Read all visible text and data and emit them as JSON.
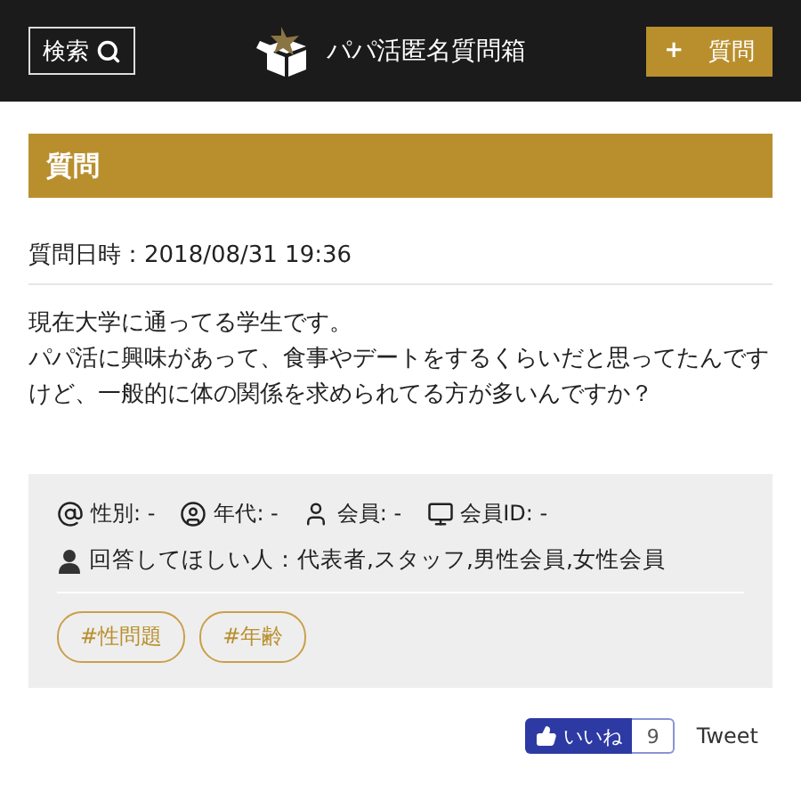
{
  "header": {
    "search_button": "検索",
    "site_title": "パパ活匿名質問箱",
    "ask_button": "+",
    "ask_label": "質問"
  },
  "section_title": "質問",
  "question": {
    "date": "質問日時：2018/08/31 19:36",
    "body": [
      "現在大学に通ってる学生です。",
      "パパ活に興味があって、食事やデートをするくらいだと思ってたんですけど、一般的に体の関係を求められてる方が多いんですか？"
    ]
  },
  "info": {
    "fields": [
      {
        "kind": "gender",
        "label": "性別: -"
      },
      {
        "kind": "age",
        "label": "年代: -"
      },
      {
        "kind": "member",
        "label": "会員: -"
      },
      {
        "kind": "member_id",
        "label": "会員ID: -"
      }
    ],
    "target": "回答してほしい人：代表者,スタッフ,男性会員,女性会員",
    "tags": [
      "#性問題",
      "#年齢"
    ]
  },
  "social": {
    "like_label": "いいね",
    "like_count": "9",
    "tweet": "Tweet"
  }
}
